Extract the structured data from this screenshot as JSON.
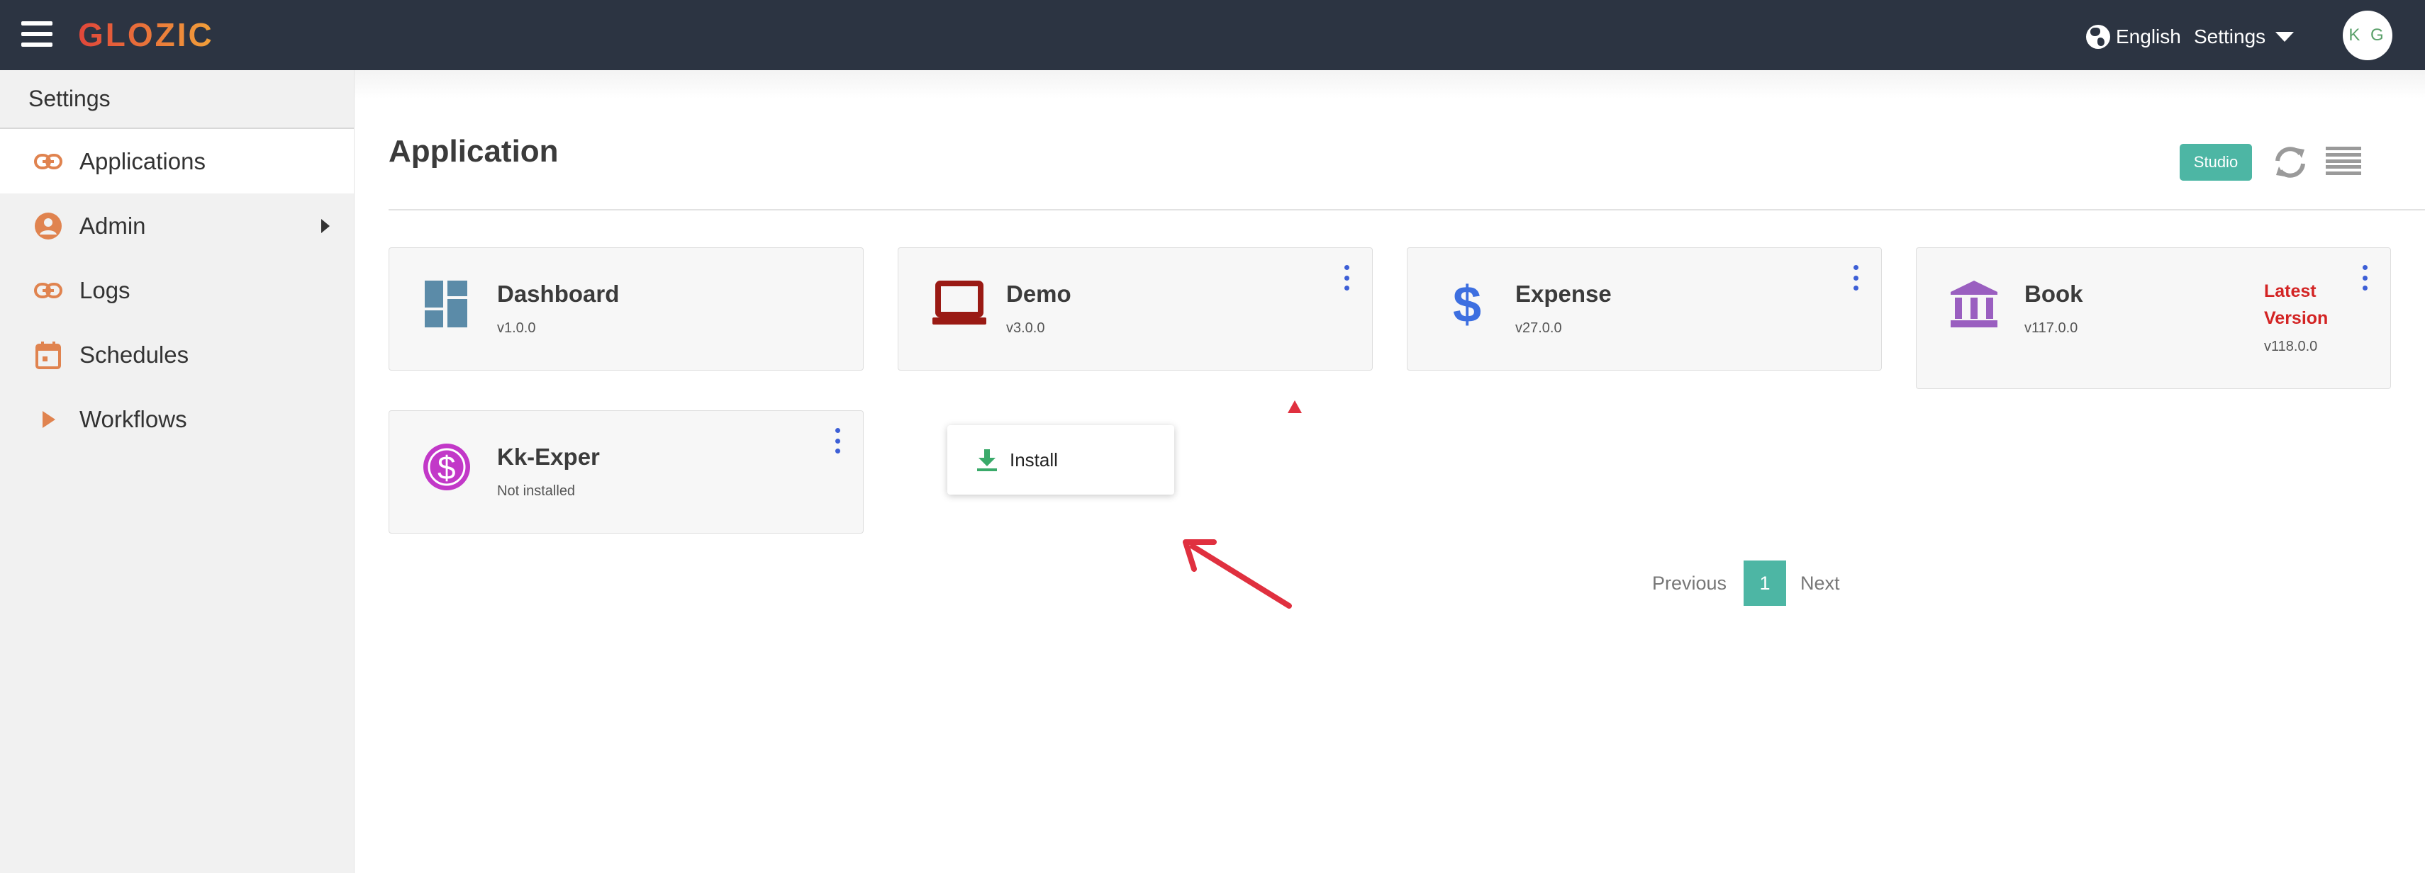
{
  "app": {
    "logo": "GLOZIC",
    "language": "English",
    "settings_label": "Settings",
    "avatar_initials": "K G"
  },
  "sidebar": {
    "header": "Settings",
    "items": [
      {
        "label": "Applications",
        "icon": "link-icon"
      },
      {
        "label": "Admin",
        "icon": "user-circle-icon"
      },
      {
        "label": "Logs",
        "icon": "link-icon"
      },
      {
        "label": "Schedules",
        "icon": "calendar-icon"
      },
      {
        "label": "Workflows",
        "icon": "play-icon"
      }
    ]
  },
  "main": {
    "title": "Application",
    "studio_label": "Studio"
  },
  "cards": [
    {
      "title": "Dashboard",
      "version": "v1.0.0",
      "icon": "dashboard-icon"
    },
    {
      "title": "Demo",
      "version": "v3.0.0",
      "icon": "laptop-icon"
    },
    {
      "title": "Expense",
      "version": "v27.0.0",
      "icon": "dollar-icon"
    },
    {
      "title": "Book",
      "version": "v117.0.0",
      "icon": "bank-icon",
      "latest_label_1": "Latest",
      "latest_label_2": "Version",
      "latest_version": "v118.0.0"
    },
    {
      "title": "Kk-Exper",
      "version": "Not installed",
      "icon": "dollar-circle-icon"
    }
  ],
  "context_menu": {
    "install_label": "Install"
  },
  "pagination": {
    "previous": "Previous",
    "current": "1",
    "next": "Next"
  },
  "colors": {
    "topbar": "#2c3442",
    "accent": "#4db6a4",
    "link_icon": "#e0834f",
    "kebab": "#3d5fd6",
    "latest": "#d32424",
    "annotation": "#e0303f"
  }
}
